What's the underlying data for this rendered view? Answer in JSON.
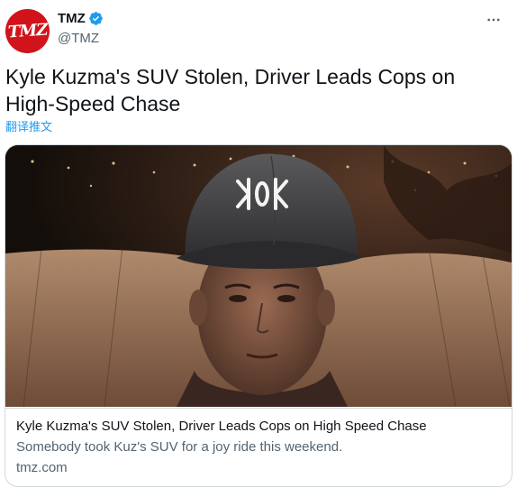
{
  "author": {
    "name": "TMZ",
    "handle": "@TMZ",
    "avatar_logo": "TMZ",
    "verified": true
  },
  "tweet": {
    "text": "Kyle Kuzma's SUV Stolen, Driver Leads Cops on High-Speed Chase",
    "translate_label": "翻译推文"
  },
  "card": {
    "title": "Kyle Kuzma's SUV Stolen, Driver Leads Cops on High Speed Chase",
    "description": "Somebody took Kuz's SUV for a joy ride this weekend.",
    "domain": "tmz.com",
    "cap_logo_text": "KK"
  },
  "icons": {
    "verified": "verified-badge-icon",
    "more": "more-options-icon"
  },
  "colors": {
    "brand_red": "#d1141b",
    "link_blue": "#1d9bf0",
    "secondary_text": "#536471",
    "border": "#cfd9de"
  }
}
